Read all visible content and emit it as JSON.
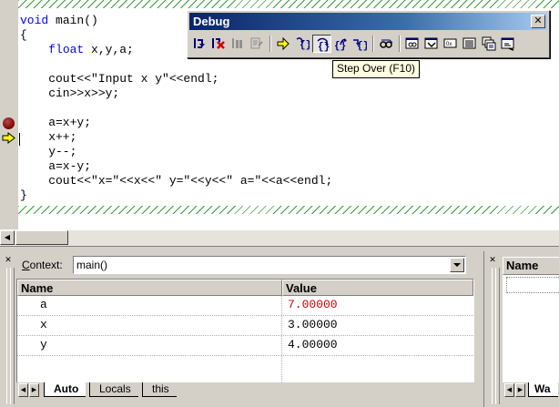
{
  "editor": {
    "lines": [
      "void main()",
      "{",
      "    float x,y,a;",
      "",
      "    cout<<\"Input x y\"<<endl;",
      "    cin>>x>>y;",
      "",
      "    a=x+y;",
      "    x++;",
      "    y--;",
      "    a=x-y;",
      "    cout<<\"x=\"<<x<<\" y=\"<<y<<\" a=\"<<a<<endl;",
      "}"
    ]
  },
  "debug_toolbar": {
    "title": "Debug",
    "close": "✕",
    "buttons": [
      {
        "name": "restart-icon"
      },
      {
        "name": "stop-debugging-icon"
      },
      {
        "name": "break-execution-icon"
      },
      {
        "name": "apply-code-changes-icon"
      },
      {
        "name": "show-next-statement-icon"
      },
      {
        "name": "step-into-icon"
      },
      {
        "name": "step-over-icon"
      },
      {
        "name": "step-out-icon"
      },
      {
        "name": "run-to-cursor-icon"
      },
      {
        "name": "quickwatch-icon"
      },
      {
        "name": "watch-window-icon"
      },
      {
        "name": "variables-window-icon"
      },
      {
        "name": "registers-window-icon"
      },
      {
        "name": "memory-window-icon"
      },
      {
        "name": "call-stack-window-icon"
      },
      {
        "name": "disassembly-window-icon"
      }
    ],
    "tooltip": "Step Over (F10)"
  },
  "variables_panel": {
    "context_label_first": "C",
    "context_label_rest": "ontext:",
    "context_value": "main()",
    "columns": [
      "Name",
      "Value"
    ],
    "rows": [
      {
        "name": "a",
        "value": "7.00000",
        "changed": true
      },
      {
        "name": "x",
        "value": "3.00000",
        "changed": false
      },
      {
        "name": "y",
        "value": "4.00000",
        "changed": false
      }
    ],
    "tabs": [
      "Auto",
      "Locals",
      "this"
    ],
    "active_tab": "Auto"
  },
  "watch_panel": {
    "column": "Name",
    "tab": "Wa"
  },
  "colors": {
    "keyword": "#0000ff",
    "changed_value": "#cc0000",
    "titlebar": "#0a246a",
    "breakpoint": "#800000",
    "exec_arrow": "#ffff00"
  }
}
